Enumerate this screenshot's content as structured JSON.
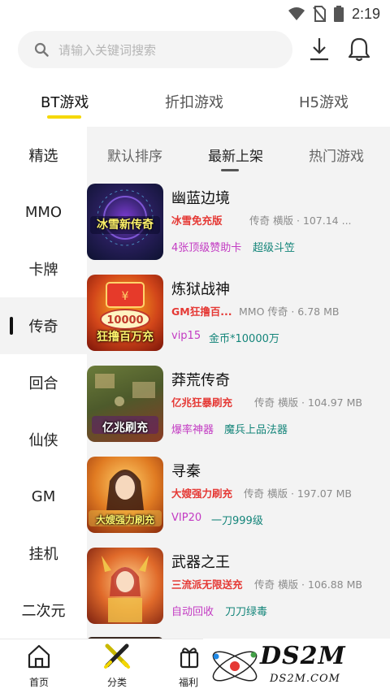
{
  "status_bar": {
    "time": "2:19",
    "icons": [
      "wifi-icon",
      "no-sim-icon",
      "battery-icon"
    ]
  },
  "search": {
    "placeholder": "请输入关键词搜索"
  },
  "main_tabs": [
    {
      "label": "BT游戏",
      "active": true
    },
    {
      "label": "折扣游戏",
      "active": false
    },
    {
      "label": "H5游戏",
      "active": false
    }
  ],
  "sidebar": {
    "items": [
      {
        "label": "精选"
      },
      {
        "label": "MMO"
      },
      {
        "label": "卡牌"
      },
      {
        "label": "传奇",
        "active": true
      },
      {
        "label": "回合"
      },
      {
        "label": "仙侠"
      },
      {
        "label": "GM"
      },
      {
        "label": "挂机"
      },
      {
        "label": "二次元"
      }
    ]
  },
  "sort_tabs": [
    {
      "label": "默认排序"
    },
    {
      "label": "最新上架",
      "active": true
    },
    {
      "label": "热门游戏"
    }
  ],
  "games": [
    {
      "name": "幽蓝边境",
      "promo": "冰雪免充版",
      "meta": "传奇 横版 · 107.14 ...",
      "tags": [
        "4张顶级赞助卡",
        "超级斗笠"
      ],
      "thumb_caption": "冰雪新传奇"
    },
    {
      "name": "炼狱战神",
      "promo": "GM狂撸百...",
      "meta": "MMO 传奇 · 6.78 MB",
      "tags": [
        "vip15",
        "金币*10000万"
      ],
      "thumb_caption": "狂撸百万充"
    },
    {
      "name": "莽荒传奇",
      "promo": "亿兆狂暴刷充",
      "meta": "传奇 横版 · 104.97 MB",
      "tags": [
        "爆率神器",
        "魔兵上品法器"
      ],
      "thumb_caption": "亿兆刷充"
    },
    {
      "name": "寻秦",
      "promo": "大嫂强力刷充",
      "meta": "传奇 横版 · 197.07 MB",
      "tags": [
        "VIP20",
        "一刀999级"
      ],
      "thumb_caption": "大嫂强力刷充"
    },
    {
      "name": "武器之王",
      "promo": "三流派无限送充",
      "meta": "传奇 横版 · 106.88 MB",
      "tags": [
        "自动回收",
        "刀刀绿毒"
      ],
      "thumb_caption": ""
    }
  ],
  "thumb_badge_text": "10000",
  "bottom_nav": [
    {
      "label": "首页",
      "icon": "home-icon"
    },
    {
      "label": "分类",
      "icon": "category-icon",
      "active": true
    },
    {
      "label": "福利",
      "icon": "gift-icon"
    }
  ],
  "watermark": {
    "brand": "DS2M",
    "site": "DS2M.COM"
  },
  "colors": {
    "accent_yellow": "#f5d800",
    "promo_red": "#e53935",
    "tag_purple": "#c33bc3",
    "tag_teal": "#14857a"
  }
}
